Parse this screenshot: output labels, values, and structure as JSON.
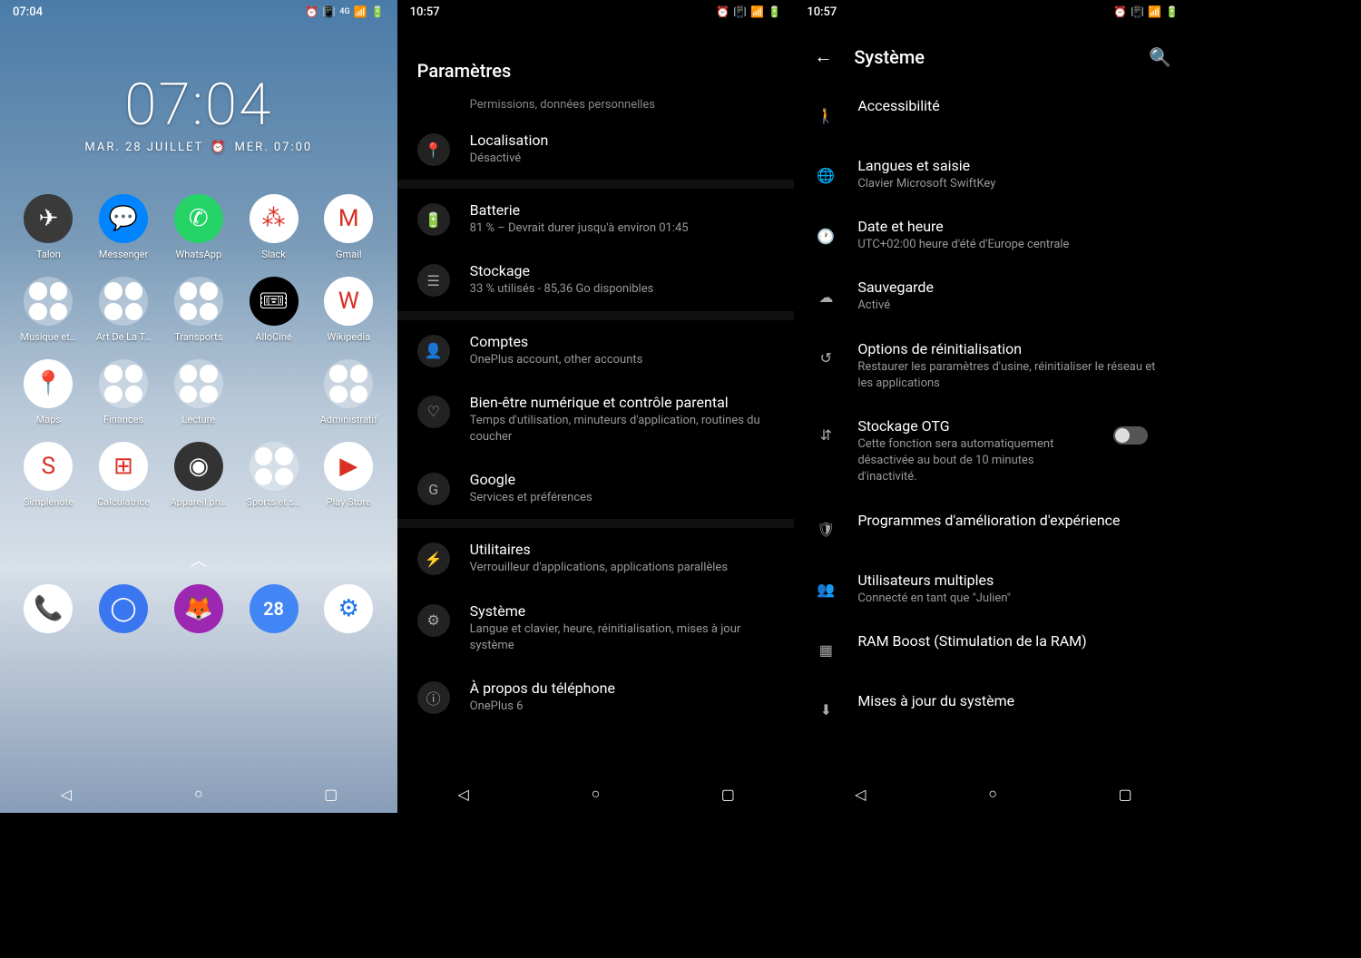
{
  "screen1": {
    "statusbar": {
      "time": "07:04"
    },
    "clock": {
      "time": "07:04",
      "date": "MAR. 28 JUILLET",
      "alarm": "MER. 07:00"
    },
    "apps_row1": [
      {
        "label": "Talon",
        "bg": "#3a3a3a",
        "icon": "✈"
      },
      {
        "label": "Messenger",
        "bg": "#0084ff",
        "icon": "💬"
      },
      {
        "label": "WhatsApp",
        "bg": "#25d366",
        "icon": "✆"
      },
      {
        "label": "Slack",
        "bg": "#fff",
        "icon": "⁂"
      },
      {
        "label": "Gmail",
        "bg": "#fff",
        "icon": "M"
      }
    ],
    "apps_row2": [
      {
        "label": "Musique et…",
        "folder": true
      },
      {
        "label": "Art De La T…",
        "folder": true
      },
      {
        "label": "Transports",
        "folder": true
      },
      {
        "label": "AlloCiné",
        "bg": "#000",
        "icon": "🎟"
      },
      {
        "label": "Wikipedia",
        "bg": "#fff",
        "icon": "W"
      }
    ],
    "apps_row3": [
      {
        "label": "Maps",
        "bg": "#fff",
        "icon": "📍"
      },
      {
        "label": "Finances",
        "folder": true
      },
      {
        "label": "Lecture",
        "folder": true
      },
      {
        "label": "",
        "folder": false,
        "empty": true
      },
      {
        "label": "Administratif",
        "folder": true
      }
    ],
    "apps_row4": [
      {
        "label": "Simplenote",
        "bg": "#fff",
        "icon": "S"
      },
      {
        "label": "Calculatrice",
        "bg": "#fff",
        "icon": "⊞"
      },
      {
        "label": "Appareil ph…",
        "bg": "#333",
        "icon": "◉"
      },
      {
        "label": "Sports et s…",
        "folder": true
      },
      {
        "label": "Play Store",
        "bg": "#fff",
        "icon": "▶"
      }
    ],
    "dock": [
      {
        "bg": "#fff",
        "icon": "📞",
        "name": "phone"
      },
      {
        "bg": "#3a76f0",
        "icon": "◯",
        "name": "signal"
      },
      {
        "bg": "#9c27b0",
        "icon": "🦊",
        "name": "firefox"
      },
      {
        "bg": "#4285f4",
        "icon": "28",
        "name": "calendar"
      },
      {
        "bg": "#fff",
        "icon": "⚙",
        "name": "settings"
      }
    ]
  },
  "screen2": {
    "statusbar": {
      "time": "10:57"
    },
    "title": "Paramètres",
    "truncated_item": "Permissions, données personnelles",
    "items": [
      {
        "icon": "📍",
        "title": "Localisation",
        "sub": "Désactivé"
      },
      {
        "icon": "🔋",
        "title": "Batterie",
        "sub": "81 % – Devrait durer jusqu'à environ 01:45"
      },
      {
        "icon": "☰",
        "title": "Stockage",
        "sub": "33 % utilisés - 85,36 Go disponibles"
      },
      {
        "icon": "👤",
        "title": "Comptes",
        "sub": "OnePlus account, other accounts"
      },
      {
        "icon": "♡",
        "title": "Bien-être numérique et contrôle parental",
        "sub": "Temps d'utilisation, minuteurs d'application, routines du coucher"
      },
      {
        "icon": "G",
        "title": "Google",
        "sub": "Services et préférences"
      },
      {
        "icon": "⚡",
        "title": "Utilitaires",
        "sub": "Verrouilleur d'applications, applications parallèles"
      },
      {
        "icon": "⚙",
        "title": "Système",
        "sub": "Langue et clavier, heure, réinitialisation, mises à jour système"
      },
      {
        "icon": "ⓘ",
        "title": "À propos du téléphone",
        "sub": "OnePlus 6"
      }
    ]
  },
  "screen3": {
    "statusbar": {
      "time": "10:57"
    },
    "title": "Système",
    "items": [
      {
        "icon": "🚶",
        "title": "Accessibilité",
        "sub": ""
      },
      {
        "icon": "🌐",
        "title": "Langues et saisie",
        "sub": "Clavier Microsoft SwiftKey"
      },
      {
        "icon": "🕐",
        "title": "Date et heure",
        "sub": "UTC+02:00 heure d'été d'Europe centrale"
      },
      {
        "icon": "☁",
        "title": "Sauvegarde",
        "sub": "Activé"
      },
      {
        "icon": "↺",
        "title": "Options de réinitialisation",
        "sub": "Restaurer les paramètres d'usine, réinitialiser le réseau et les applications"
      },
      {
        "icon": "⇵",
        "title": "Stockage OTG",
        "sub": "Cette fonction sera automatiquement désactivée au bout de 10 minutes d'inactivité.",
        "toggle": true
      },
      {
        "icon": "🛡",
        "title": "Programmes d'amélioration d'expérience",
        "sub": ""
      },
      {
        "icon": "👥",
        "title": "Utilisateurs multiples",
        "sub": "Connecté en tant que \"Julien\""
      },
      {
        "icon": "▦",
        "title": "RAM Boost (Stimulation de la RAM)",
        "sub": ""
      },
      {
        "icon": "⬇",
        "title": "Mises à jour du système",
        "sub": ""
      }
    ]
  }
}
